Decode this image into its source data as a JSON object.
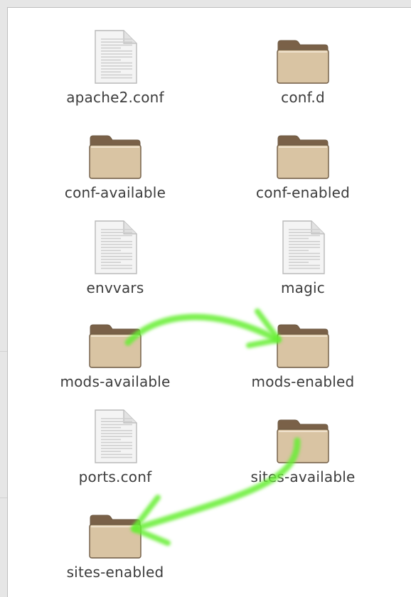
{
  "files": [
    {
      "name": "apache2.conf",
      "kind": "file",
      "icon": "text-file-icon"
    },
    {
      "name": "conf.d",
      "kind": "folder",
      "icon": "folder-icon"
    },
    {
      "name": "conf-available",
      "kind": "folder",
      "icon": "folder-icon"
    },
    {
      "name": "conf-enabled",
      "kind": "folder",
      "icon": "folder-icon"
    },
    {
      "name": "envvars",
      "kind": "file",
      "icon": "text-file-icon"
    },
    {
      "name": "magic",
      "kind": "file",
      "icon": "text-file-icon"
    },
    {
      "name": "mods-available",
      "kind": "folder",
      "icon": "folder-icon"
    },
    {
      "name": "mods-enabled",
      "kind": "folder",
      "icon": "folder-icon"
    },
    {
      "name": "ports.conf",
      "kind": "file",
      "icon": "text-file-icon"
    },
    {
      "name": "sites-available",
      "kind": "folder",
      "icon": "folder-icon"
    },
    {
      "name": "sites-enabled",
      "kind": "folder",
      "icon": "folder-icon"
    }
  ],
  "annotations": {
    "arrow_color": "#66ee33"
  },
  "colors": {
    "folder_body": "#d9c4a3",
    "folder_tab": "#7a6148",
    "folder_stroke": "#6e5a43",
    "file_page": "#f4f4f4",
    "label_text": "#3c3c3c"
  }
}
